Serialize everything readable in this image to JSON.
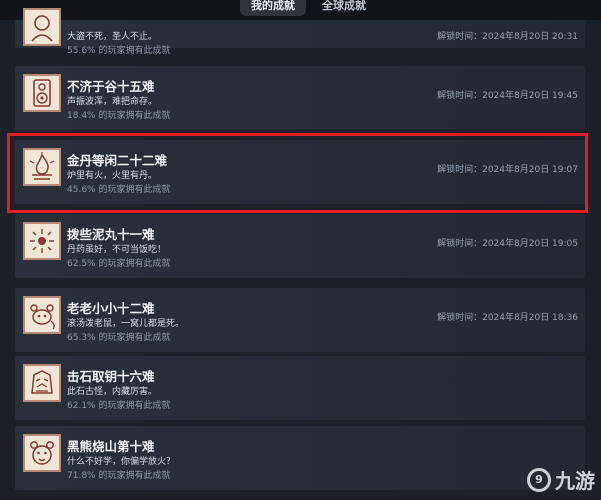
{
  "tabs": {
    "active": "我的成就",
    "other": "全球成就"
  },
  "achievements": [
    {
      "title": "",
      "desc": "大盗不死，圣人不止。",
      "pct": "55.6% 的玩家拥有此成就",
      "time": "解锁时间：2024年8月20日 20:31",
      "icon": "monk-portrait-icon"
    },
    {
      "title": "不济于谷十五难",
      "desc": "声振波浑，难把命存。",
      "pct": "18.4% 的玩家拥有此成就",
      "time": "解锁时间：2024年8月20日 19:45",
      "icon": "speaker-icon"
    },
    {
      "title": "金丹等闲二十二难",
      "desc": "炉里有火，火里有丹。",
      "pct": "45.6% 的玩家拥有此成就",
      "time": "解锁时间：2024年8月20日 19:07",
      "icon": "furnace-flame-icon"
    },
    {
      "title": "拨些泥丸十一难",
      "desc": "丹药虽好，不可当饭吃！",
      "pct": "62.5% 的玩家拥有此成就",
      "time": "解锁时间：2024年8月20日 19:05",
      "icon": "pill-burst-icon"
    },
    {
      "title": "老老小小十二难",
      "desc": "滚汤泼老鼠，一窝儿都是死。",
      "pct": "65.3% 的玩家拥有此成就",
      "time": "解锁时间：2024年8月20日 18:36",
      "icon": "rat-icon"
    },
    {
      "title": "击石取钥十六难",
      "desc": "此石古怪，内藏厉害。",
      "pct": "62.1% 的玩家拥有此成就",
      "time": "",
      "icon": "stone-mask-icon"
    },
    {
      "title": "黑熊烧山第十难",
      "desc": "什么不好学，你偏学放火？",
      "pct": "71.8% 的玩家拥有此成就",
      "time": "",
      "icon": "bear-face-icon"
    }
  ],
  "watermark": {
    "mark": "9",
    "text": "九游"
  },
  "colors": {
    "highlight": "#e31b23",
    "icon_border": "#b98a78",
    "icon_bg": "#efe6d6"
  }
}
